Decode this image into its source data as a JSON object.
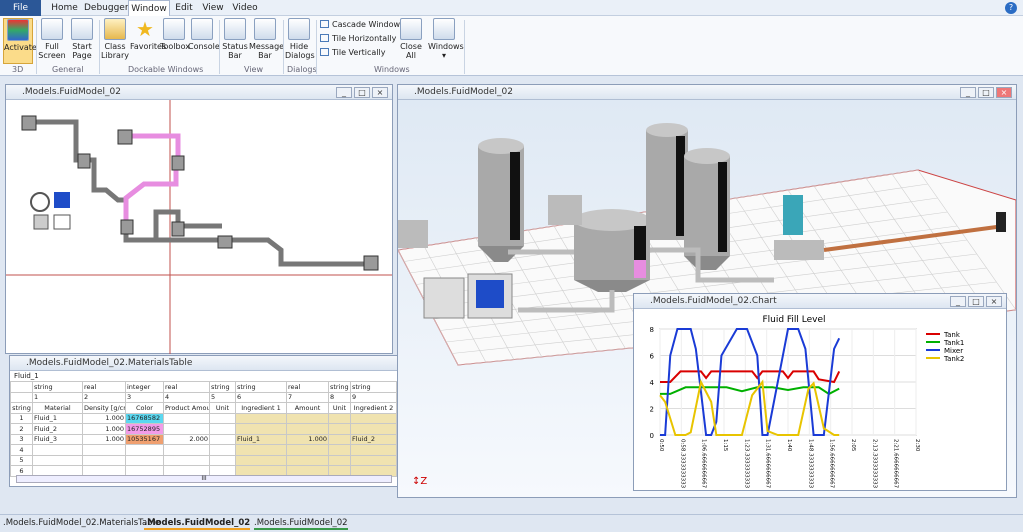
{
  "menu": {
    "file": "File",
    "home": "Home",
    "debugger": "Debugger",
    "window": "Window",
    "edit": "Edit",
    "view": "View",
    "video": "Video"
  },
  "ribbon": {
    "activate": "Activate",
    "full_screen": "Full Screen",
    "start_page": "Start Page",
    "class_library": "Class Library",
    "favorites": "Favorites",
    "toolbox": "Toolbox",
    "console": "Console",
    "status_bar": "Status Bar",
    "message_bar": "Message Bar",
    "hide_dialogs": "Hide Dialogs",
    "cascade": "Cascade Windows",
    "tile_h": "Tile Horizontally",
    "tile_v": "Tile Vertically",
    "close_all": "Close All",
    "windows": "Windows",
    "groups": {
      "g3d": "3D",
      "general": "General",
      "dockable": "Dockable Windows",
      "view": "View",
      "dialogs": "Dialogs",
      "windows": "Windows"
    }
  },
  "windows": {
    "model2d": ".Models.FuidModel_02",
    "model3d": ".Models.FuidModel_02",
    "table": ".Models.FuidModel_02.MaterialsTable",
    "chart": ".Models.FuidModel_02.Chart"
  },
  "table": {
    "name": "Fluid_1",
    "types": [
      "string",
      "real",
      "integer",
      "real",
      "string",
      "string",
      "real",
      "string",
      "string"
    ],
    "nums": [
      "1",
      "2",
      "3",
      "4",
      "5",
      "6",
      "7",
      "8",
      "9"
    ],
    "headers": [
      "Material",
      "Density [g/cm³]",
      "Color",
      "Product Amount",
      "Unit",
      "Ingredient 1",
      "Amount",
      "Unit",
      "Ingredient 2"
    ],
    "rowhead": "string",
    "rows": [
      {
        "n": "1",
        "material": "Fluid_1",
        "density": "1.000",
        "color": "16768582",
        "amount": "",
        "ing1": "",
        "amt": "",
        "ing2": ""
      },
      {
        "n": "2",
        "material": "Fluid_2",
        "density": "1.000",
        "color": "16752895",
        "amount": "",
        "ing1": "",
        "amt": "",
        "ing2": ""
      },
      {
        "n": "3",
        "material": "Fluid_3",
        "density": "1.000",
        "color": "10535167",
        "amount": "2.000",
        "ing1": "Fluid_1",
        "amt": "1.000",
        "ing2": "Fluid_2"
      },
      {
        "n": "4"
      },
      {
        "n": "5"
      },
      {
        "n": "6"
      }
    ],
    "scroll_mark": "III"
  },
  "tabs": [
    ".Models.FuidModel_02.MaterialsTable",
    ".Models.FuidModel_02",
    ".Models.FuidModel_02"
  ],
  "colors": {
    "tank": "#d90000",
    "tank1": "#00b000",
    "mixer": "#1a3bd6",
    "tank2": "#e8c400",
    "pink": "#e78de0"
  },
  "chart_data": {
    "type": "line",
    "title": "Fluid Fill Level",
    "ylim": [
      0,
      8
    ],
    "yticks": [
      "0",
      "2",
      "4",
      "6",
      "8"
    ],
    "xlim": [
      0,
      2.5
    ],
    "xticks": [
      "0:50",
      "0:58.3333333333",
      "1:06.6666666667",
      "1:15",
      "1:23.3333333333",
      "1:31.6666666667",
      "1:40",
      "1:48.3333333333",
      "1:56.6666666667",
      "2:05",
      "2:13.3333333333",
      "2:21.6666666667",
      "2:30"
    ],
    "legend_position": "right",
    "series": [
      {
        "name": "Tank",
        "color": "#d90000",
        "x": [
          0,
          0.1,
          0.2,
          0.4,
          0.45,
          0.5,
          0.6,
          0.7,
          0.9,
          0.95,
          1.0,
          1.15,
          1.2,
          1.25,
          1.3,
          1.45,
          1.5,
          1.55,
          1.7,
          1.75
        ],
        "y": [
          4,
          4,
          4.8,
          4.8,
          4.3,
          4.8,
          4.8,
          4.8,
          4.8,
          4.3,
          4.8,
          4.8,
          4.8,
          4.3,
          4.8,
          4.8,
          4.8,
          4.2,
          4.0,
          4.8
        ]
      },
      {
        "name": "Tank1",
        "color": "#00b000",
        "x": [
          0,
          0.1,
          0.25,
          0.4,
          0.5,
          0.65,
          0.8,
          0.95,
          1.1,
          1.25,
          1.4,
          1.55,
          1.65,
          1.75
        ],
        "y": [
          3.1,
          3.1,
          3.6,
          3.6,
          3.6,
          3.6,
          3.3,
          3.6,
          3.6,
          3.4,
          3.6,
          3.6,
          3.1,
          3.5
        ]
      },
      {
        "name": "Mixer",
        "color": "#1a3bd6",
        "x": [
          0,
          0.05,
          0.1,
          0.17,
          0.3,
          0.35,
          0.45,
          0.5,
          0.55,
          0.6,
          0.75,
          0.85,
          0.95,
          1.0,
          1.05,
          1.1,
          1.25,
          1.35,
          1.42,
          1.5,
          1.6,
          1.7,
          1.75
        ],
        "y": [
          0,
          0,
          6,
          8,
          8,
          6.5,
          0,
          0,
          1,
          6,
          8,
          8,
          6,
          0,
          0,
          2,
          8,
          8,
          6.5,
          0,
          0,
          6.5,
          7.3
        ]
      },
      {
        "name": "Tank2",
        "color": "#e8c400",
        "x": [
          0,
          0.05,
          0.15,
          0.25,
          0.3,
          0.4,
          0.5,
          0.55,
          0.6,
          0.7,
          0.8,
          0.9,
          1.0,
          1.05,
          1.15,
          1.25,
          1.35,
          1.45,
          1.5,
          1.6,
          1.7,
          1.75
        ],
        "y": [
          3,
          2.5,
          0,
          0,
          0.2,
          4,
          2.5,
          0,
          0,
          0,
          0,
          3,
          4,
          0.3,
          0,
          0,
          0,
          3.5,
          3.9,
          0.5,
          0,
          0
        ]
      }
    ]
  }
}
